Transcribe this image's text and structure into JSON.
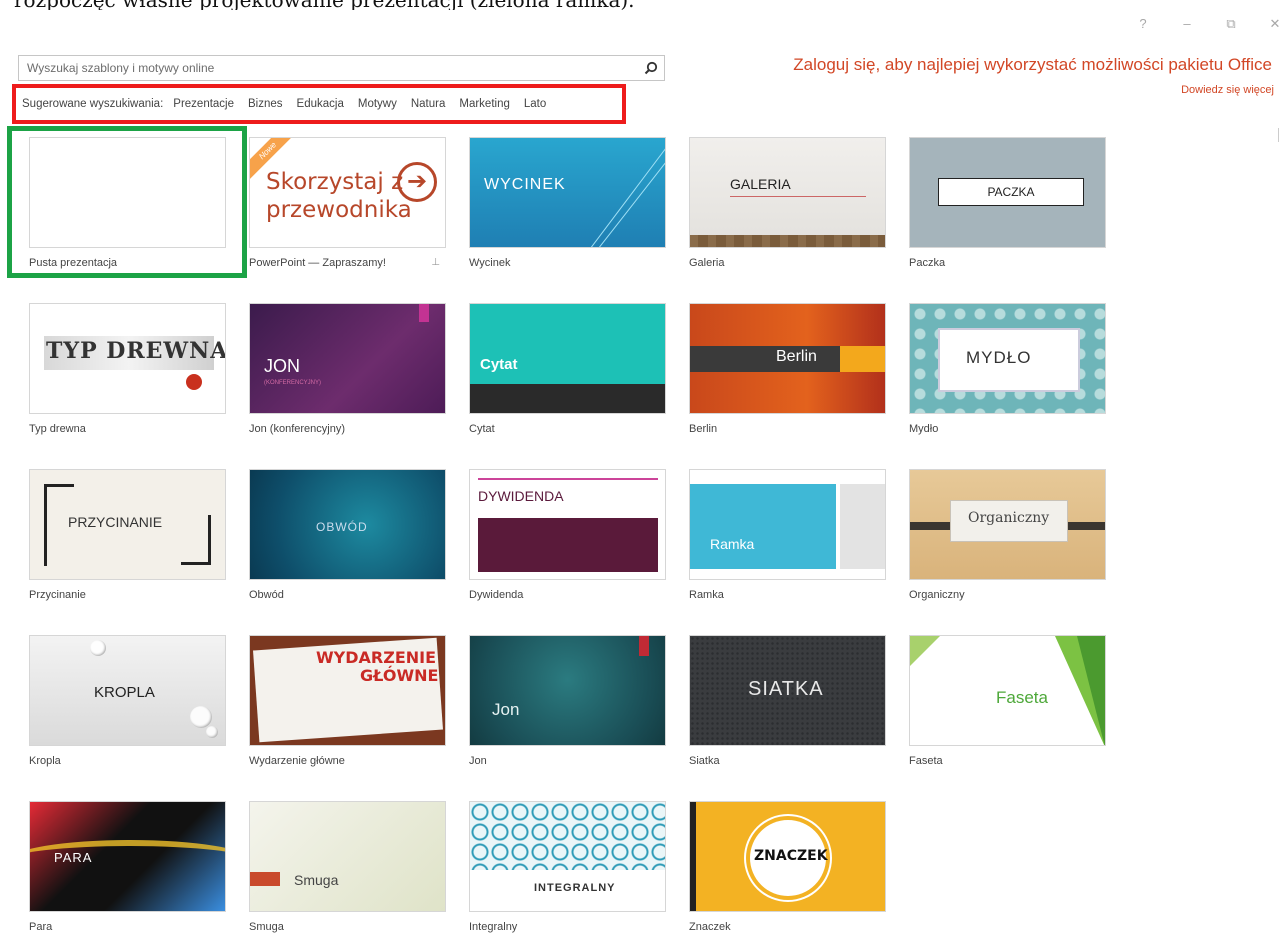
{
  "caption": "rozpoczęć własne projektowanie prezentacji (zielona ramka).",
  "window": {
    "help": "?",
    "minimize": "–",
    "restore": "⧉",
    "close": "✕"
  },
  "search": {
    "placeholder": "Wyszukaj szablony i motywy online",
    "value": ""
  },
  "suggested": {
    "label": "Sugerowane wyszukiwania:",
    "items": [
      "Prezentacje",
      "Biznes",
      "Edukacja",
      "Motywy",
      "Natura",
      "Marketing",
      "Lato"
    ]
  },
  "signin": {
    "text": "Zaloguj się, aby najlepiej wykorzystać możliwości pakietu Office",
    "link": "Dowiedz się więcej"
  },
  "colors": {
    "accent": "#d24726",
    "red_frame": "#ee1c1c",
    "green_frame": "#1ca346"
  },
  "templates": [
    {
      "name": "Pusta prezentacja"
    },
    {
      "name": "PowerPoint — Zapraszamy!",
      "badge": "Nowe",
      "title": "Skorzystaj z przewodnika",
      "arrow": "➔",
      "pin": "⊥"
    },
    {
      "name": "Wycinek",
      "title": "WYCINEK"
    },
    {
      "name": "Galeria",
      "title": "GALERIA"
    },
    {
      "name": "Paczka",
      "title": "PACZKA"
    },
    {
      "name": "Typ drewna",
      "title": "TYP DREWNA"
    },
    {
      "name": "Jon (konferencyjny)",
      "title": "JON",
      "subtitle": "(KONFERENCYJNY)"
    },
    {
      "name": "Cytat",
      "title": "Cytat"
    },
    {
      "name": "Berlin",
      "title": "Berlin"
    },
    {
      "name": "Mydło",
      "title": "MYDŁO"
    },
    {
      "name": "Przycinanie",
      "title": "PRZYCINANIE"
    },
    {
      "name": "Obwód",
      "title": "OBWÓD"
    },
    {
      "name": "Dywidenda",
      "title": "DYWIDENDA"
    },
    {
      "name": "Ramka",
      "title": "Ramka"
    },
    {
      "name": "Organiczny",
      "title": "Organiczny"
    },
    {
      "name": "Kropla",
      "title": "KROPLA"
    },
    {
      "name": "Wydarzenie główne",
      "title": "WYDARZENIE",
      "title2": "GŁÓWNE"
    },
    {
      "name": "Jon",
      "title": "Jon"
    },
    {
      "name": "Siatka",
      "title": "SIATKA"
    },
    {
      "name": "Faseta",
      "title": "Faseta"
    },
    {
      "name": "Para",
      "title": "PARA"
    },
    {
      "name": "Smuga",
      "title": "Smuga"
    },
    {
      "name": "Integralny",
      "title": "INTEGRALNY"
    },
    {
      "name": "Znaczek",
      "title": "ZNACZEK"
    }
  ]
}
